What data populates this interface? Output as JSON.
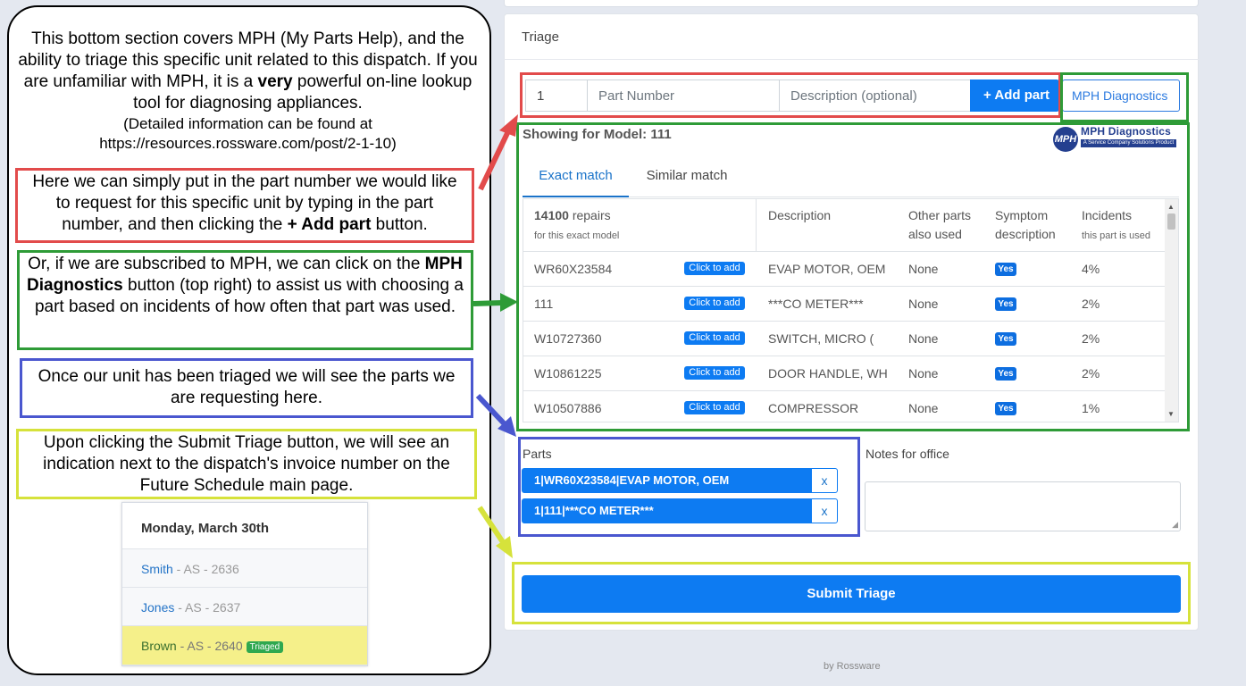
{
  "left_panel": {
    "intro_pre": "This bottom section covers MPH (My Parts Help), and the ability to triage this specific unit related to this dispatch. If you are unfamiliar with MPH, it is a ",
    "intro_bold": "very",
    "intro_post": " powerful on-line lookup tool for diagnosing appliances.",
    "intro_small_1": "(Detailed information can be found at",
    "intro_small_2": "https://resources.rossware.com/post/2-1-10)",
    "red_pre": "Here we can simply put in the part number we would like to request for this specific unit by typing in the part number, and then clicking the ",
    "red_bold": "+ Add part",
    "red_post": " button.",
    "green_pre": "Or, if we are subscribed to MPH, we can click on the ",
    "green_bold": "MPH Diagnostics",
    "green_post": " button (top right) to assist us with choosing a part based on incidents of how often that part was used.",
    "blue": "Once our unit has been triaged we will see the parts we are requesting here.",
    "yellow": "Upon clicking the Submit Triage button, we will see an indication next to the dispatch's invoice number on the Future Schedule main page."
  },
  "schedule": {
    "day": "Monday, March 30th",
    "rows": [
      {
        "name": "Smith",
        "code": " - AS - 2636",
        "badge": ""
      },
      {
        "name": "Jones",
        "code": " - AS - 2637",
        "badge": ""
      },
      {
        "name": "Brown",
        "code": " - AS - 2640",
        "badge": "Triaged"
      }
    ]
  },
  "triage": {
    "title": "Triage",
    "qty_value": "1",
    "part_placeholder": "Part Number",
    "desc_placeholder": "Description (optional)",
    "add_part": "+ Add part",
    "mph_button": "MPH Diagnostics",
    "showing": "Showing for Model: 111",
    "logo_title": "MPH Diagnostics",
    "logo_sub": "A Service Company Solutions Product",
    "logo_mark": "MPH",
    "tabs": [
      "Exact match",
      "Similar match"
    ],
    "headers": {
      "repairs_count": "14100",
      "repairs_word": " repairs",
      "repairs_sub": "for this exact model",
      "description": "Description",
      "other_1": "Other parts",
      "other_2": "also used",
      "symptom_1": "Symptom",
      "symptom_2": "description",
      "incidents": "Incidents",
      "incidents_sub": "this part is used"
    },
    "click_to_add": "Click to add",
    "rows": [
      {
        "part": "WR60X23584",
        "desc": "EVAP MOTOR, OEM",
        "other": "None",
        "symptom": "Yes",
        "incidents": "4%"
      },
      {
        "part": "111",
        "desc": "***CO METER***",
        "other": "None",
        "symptom": "Yes",
        "incidents": "2%"
      },
      {
        "part": "W10727360",
        "desc": "SWITCH, MICRO (",
        "other": "None",
        "symptom": "Yes",
        "incidents": "2%"
      },
      {
        "part": "W10861225",
        "desc": "DOOR HANDLE, WH",
        "other": "None",
        "symptom": "Yes",
        "incidents": "2%"
      },
      {
        "part": "W10507886",
        "desc": "COMPRESSOR",
        "other": "None",
        "symptom": "Yes",
        "incidents": "1%"
      }
    ],
    "parts_label": "Parts",
    "parts": [
      "1|WR60X23584|EVAP MOTOR, OEM",
      "1|111|***CO METER***"
    ],
    "remove": "x",
    "notes_label": "Notes for office",
    "submit": "Submit Triage",
    "footer": "by Rossware"
  },
  "colors": {
    "primary": "#0d7bf2",
    "red": "#e24b4b",
    "green": "#2e9b37",
    "blue": "#4a57cf",
    "yellow": "#d6e23b"
  }
}
